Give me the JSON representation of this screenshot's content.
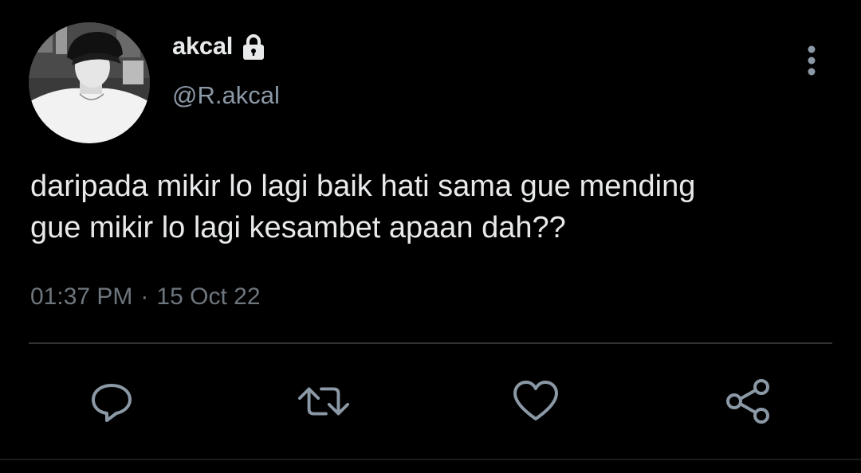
{
  "user": {
    "display_name": "akcal",
    "handle": "@R.akcal",
    "protected_icon": "lock-icon",
    "avatar": "avatar-photo"
  },
  "tweet": {
    "lines": [
      "daripada mikir lo lagi baik hati sama gue mending",
      "gue mikir lo lagi kesambet apaan dah??"
    ],
    "time": "01:37 PM",
    "separator": "·",
    "date": "15 Oct 22"
  },
  "actions": [
    {
      "name": "reply",
      "icon": "reply-icon"
    },
    {
      "name": "retweet",
      "icon": "retweet-icon"
    },
    {
      "name": "like",
      "icon": "heart-icon"
    },
    {
      "name": "share",
      "icon": "share-icon"
    }
  ],
  "menu_icon": "more-vertical-icon",
  "colors": {
    "background": "#000000",
    "primary_text": "#e7e9ea",
    "secondary_text": "#8b98a5",
    "meta_text": "#6e767d",
    "divider": "#2f3336",
    "icon": "#8b98a5"
  }
}
